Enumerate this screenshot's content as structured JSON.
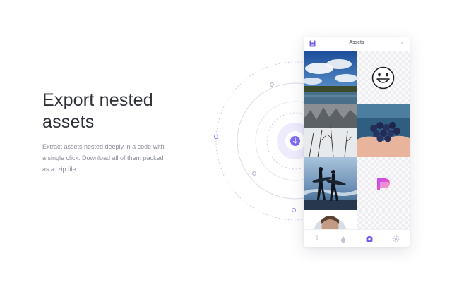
{
  "feature": {
    "headline_line1": "Export nested",
    "headline_line2": "assets",
    "description": "Extract assets nested deeply in a code with a single click. Download all of them packed as a .zip file."
  },
  "panel": {
    "title": "Assets",
    "close_glyph": "×",
    "tab_text_glyph": "T",
    "active_tab": "images"
  },
  "assets": [
    {
      "name": "coastal-sky-photo",
      "kind": "photo"
    },
    {
      "name": "smiley-face-icon",
      "kind": "vector"
    },
    {
      "name": "snowy-forest-photo",
      "kind": "photo"
    },
    {
      "name": "blueberries-photo",
      "kind": "photo"
    },
    {
      "name": "surfers-beach-photo",
      "kind": "photo"
    },
    {
      "name": "brand-logo",
      "kind": "vector"
    },
    {
      "name": "person-portrait-photo",
      "kind": "photo"
    }
  ],
  "colors": {
    "accent": "#6f5cf0",
    "headline": "#2f3139",
    "description": "#8a8d99"
  }
}
